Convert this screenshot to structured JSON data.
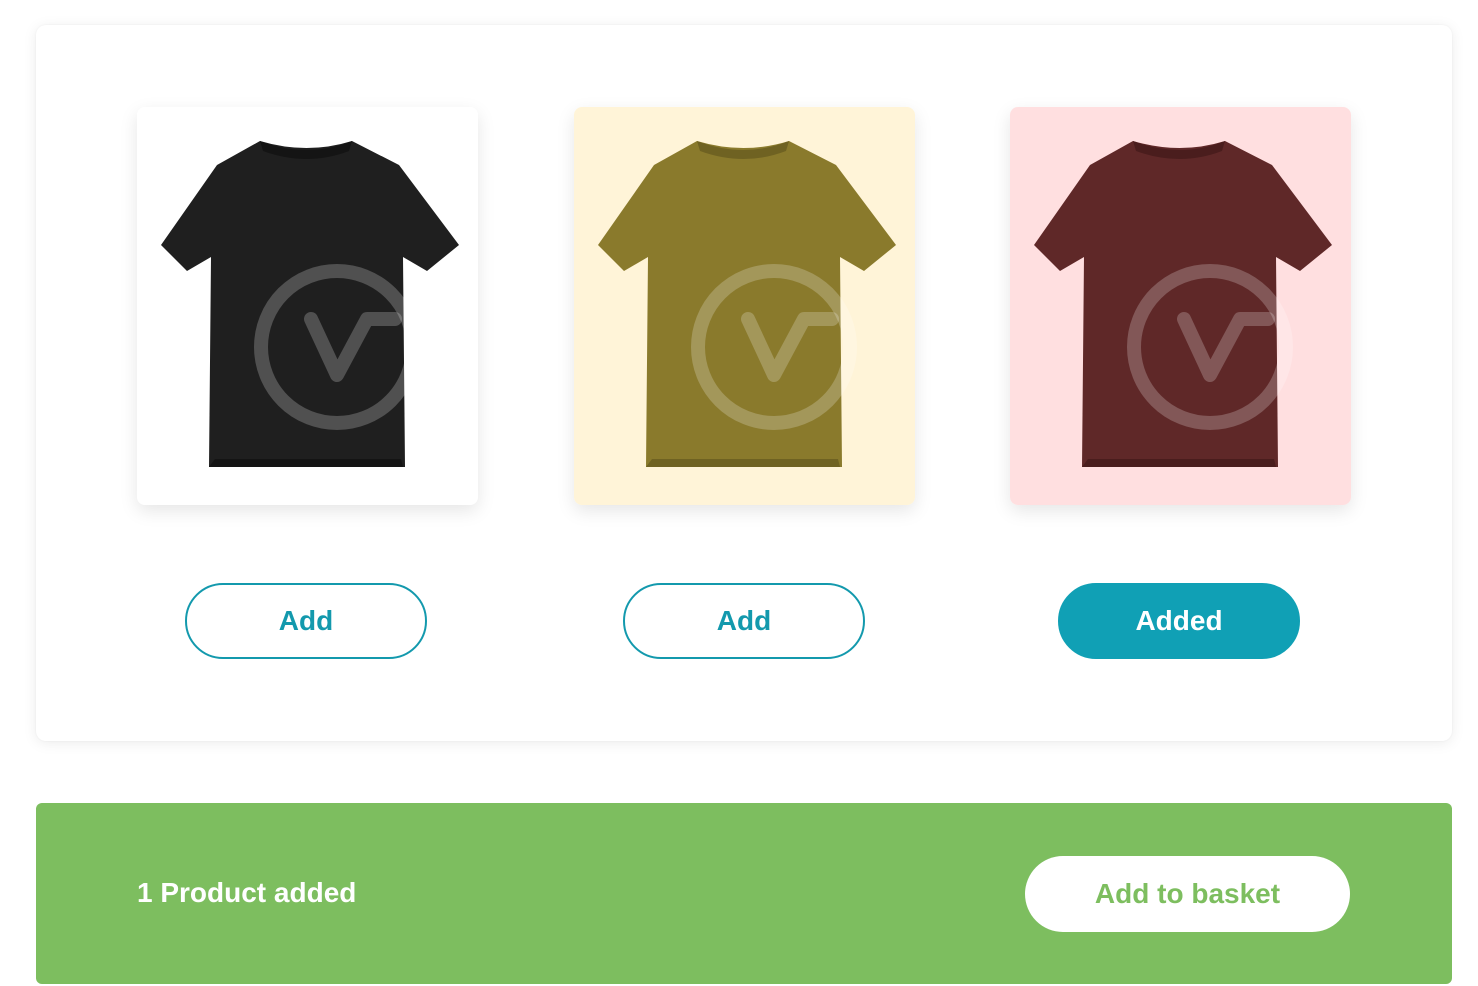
{
  "products": [
    {
      "name": "Black T-shirt",
      "card_bg": "#ffffff",
      "shirt_color": "#1f1f1f",
      "shirt_shade": "#141414",
      "button_label": "Add",
      "added": false
    },
    {
      "name": "Olive T-shirt",
      "card_bg": "#fff4d8",
      "shirt_color": "#8a7a2c",
      "shirt_shade": "#6f6222",
      "button_label": "Add",
      "added": false
    },
    {
      "name": "Maroon T-shirt",
      "card_bg": "#ffdfe0",
      "shirt_color": "#5f2828",
      "shirt_shade": "#4a1d1d",
      "button_label": "Added",
      "added": true
    }
  ],
  "basket": {
    "status_text": "1 Product added",
    "button_label": "Add to basket"
  },
  "colors": {
    "accent": "#10a0b5",
    "basket_bar": "#7dbe5f",
    "watermark": "rgba(255,255,255,0.22)"
  },
  "icons": {
    "product_image": "t-shirt-icon",
    "watermark": "wc-logo-watermark-icon"
  }
}
